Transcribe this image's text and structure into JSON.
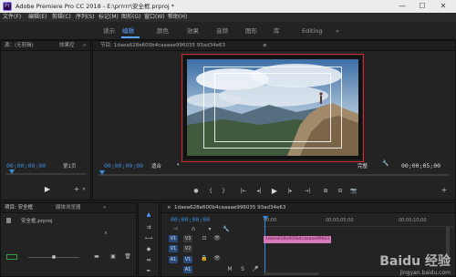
{
  "titlebar": {
    "title": "Adobe Premiere Pro CC 2018 - E:\\prrrrr\\安全框.prproj *",
    "app_icon_text": "Pr",
    "minimize": "—",
    "maximize": "☐",
    "close": "✕"
  },
  "menu": [
    "文件(F)",
    "编辑(E)",
    "剪辑(C)",
    "序列(S)",
    "标记(M)",
    "图形(G)",
    "窗口(W)",
    "帮助(H)"
  ],
  "workspace_tabs": [
    "读示",
    "编辑",
    "颜色",
    "效果",
    "音频",
    "图形",
    "库",
    "Editing"
  ],
  "workspace_more": "»",
  "source_panel": {
    "tab1": "源：(无剪辑)",
    "tab2": "效果控",
    "more": "»",
    "timecode": "00;00;00;00",
    "page": "第1页"
  },
  "program_panel": {
    "tab": "节目: 1daea628e600b4caaaae996035 93ad34e63",
    "menu_icon": "≡",
    "timecode_left": "00;00;00;00",
    "fit": "适合",
    "quality": "完整",
    "timecode_right": "00;00;05;00",
    "transport": [
      "●",
      "{",
      "}",
      "|←",
      "◂|",
      "▶",
      "|▸",
      "→|",
      "⊞",
      "⊟",
      "📷"
    ]
  },
  "project_panel": {
    "tab1": "项目: 安全框",
    "tab2": "媒体浏览器",
    "more": "»",
    "file": "安全框.prproj"
  },
  "timeline_panel": {
    "tab": "1daea628e600b4caaaae996035 93ad34e63",
    "timecode": "00;00;00;00",
    "ruler_ticks": [
      "00;00",
      "00;00;05;00",
      "00;00;10;00"
    ],
    "tracks": [
      "V3",
      "V2",
      "V1",
      "A1",
      "A2"
    ],
    "track_labels": [
      "V1",
      "V1",
      "A1"
    ]
  },
  "watermark": {
    "main": "Baidu 经验",
    "sub": "jingyan.baidu.com"
  },
  "colors": {
    "accent": "#3d8bd9",
    "selection": "#d6262d",
    "clip": "#d97ab8"
  }
}
